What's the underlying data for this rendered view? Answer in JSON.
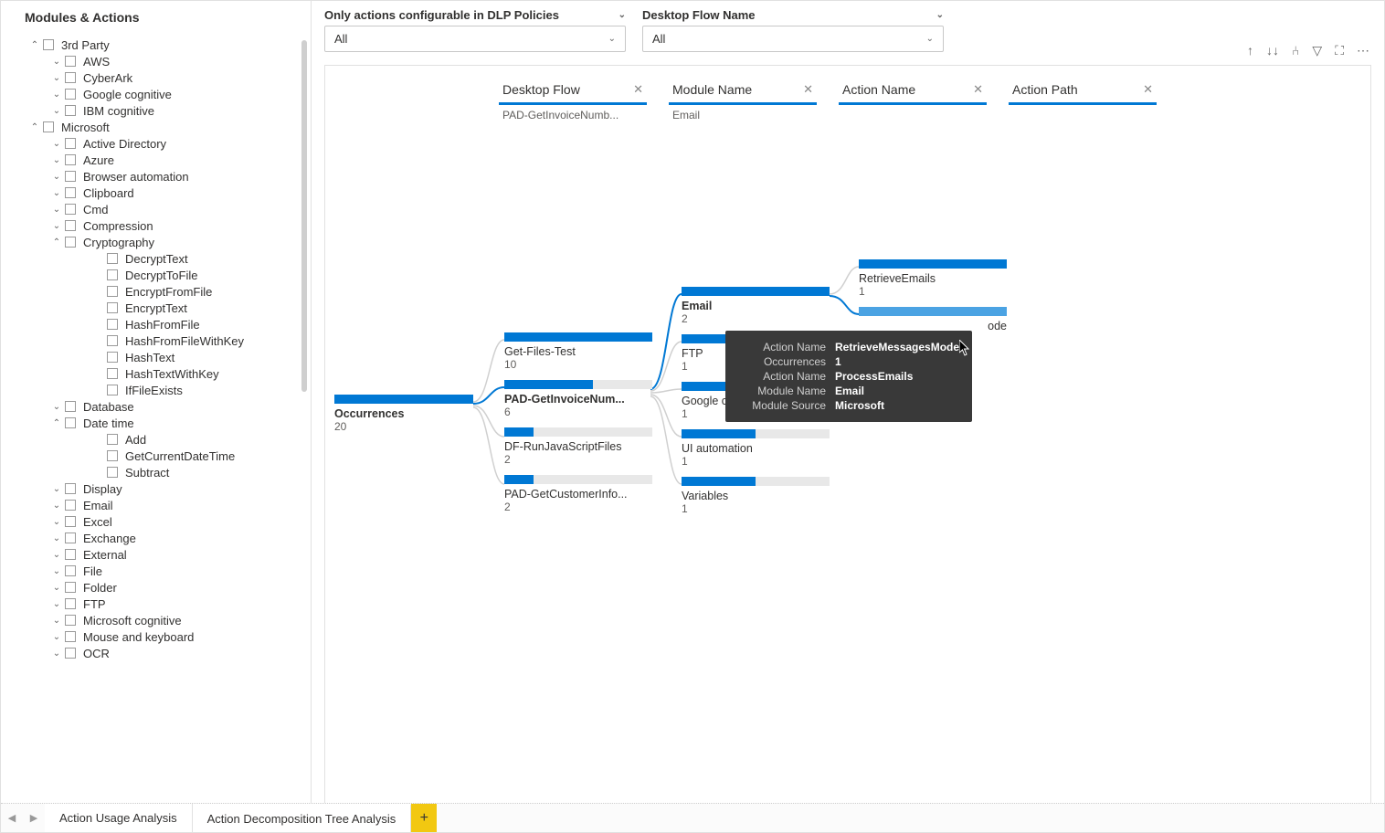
{
  "sidebar": {
    "title": "Modules & Actions",
    "tree": [
      {
        "label": "3rd Party",
        "indent": 0,
        "chev": "up"
      },
      {
        "label": "AWS",
        "indent": 1,
        "chev": "down"
      },
      {
        "label": "CyberArk",
        "indent": 1,
        "chev": "down"
      },
      {
        "label": "Google cognitive",
        "indent": 1,
        "chev": "down"
      },
      {
        "label": "IBM cognitive",
        "indent": 1,
        "chev": "down"
      },
      {
        "label": "Microsoft",
        "indent": 0,
        "chev": "up"
      },
      {
        "label": "Active Directory",
        "indent": 1,
        "chev": "down"
      },
      {
        "label": "Azure",
        "indent": 1,
        "chev": "down"
      },
      {
        "label": "Browser automation",
        "indent": 1,
        "chev": "down"
      },
      {
        "label": "Clipboard",
        "indent": 1,
        "chev": "down"
      },
      {
        "label": "Cmd",
        "indent": 1,
        "chev": "down"
      },
      {
        "label": "Compression",
        "indent": 1,
        "chev": "down"
      },
      {
        "label": "Cryptography",
        "indent": 1,
        "chev": "up"
      },
      {
        "label": "DecryptText",
        "indent": 2,
        "chev": ""
      },
      {
        "label": "DecryptToFile",
        "indent": 2,
        "chev": ""
      },
      {
        "label": "EncryptFromFile",
        "indent": 2,
        "chev": ""
      },
      {
        "label": "EncryptText",
        "indent": 2,
        "chev": ""
      },
      {
        "label": "HashFromFile",
        "indent": 2,
        "chev": ""
      },
      {
        "label": "HashFromFileWithKey",
        "indent": 2,
        "chev": ""
      },
      {
        "label": "HashText",
        "indent": 2,
        "chev": ""
      },
      {
        "label": "HashTextWithKey",
        "indent": 2,
        "chev": ""
      },
      {
        "label": "IfFileExists",
        "indent": 2,
        "chev": ""
      },
      {
        "label": "Database",
        "indent": 1,
        "chev": "down"
      },
      {
        "label": "Date time",
        "indent": 1,
        "chev": "up"
      },
      {
        "label": "Add",
        "indent": 2,
        "chev": ""
      },
      {
        "label": "GetCurrentDateTime",
        "indent": 2,
        "chev": ""
      },
      {
        "label": "Subtract",
        "indent": 2,
        "chev": ""
      },
      {
        "label": "Display",
        "indent": 1,
        "chev": "down"
      },
      {
        "label": "Email",
        "indent": 1,
        "chev": "down"
      },
      {
        "label": "Excel",
        "indent": 1,
        "chev": "down"
      },
      {
        "label": "Exchange",
        "indent": 1,
        "chev": "down"
      },
      {
        "label": "External",
        "indent": 1,
        "chev": "down"
      },
      {
        "label": "File",
        "indent": 1,
        "chev": "down"
      },
      {
        "label": "Folder",
        "indent": 1,
        "chev": "down"
      },
      {
        "label": "FTP",
        "indent": 1,
        "chev": "down"
      },
      {
        "label": "Microsoft cognitive",
        "indent": 1,
        "chev": "down"
      },
      {
        "label": "Mouse and keyboard",
        "indent": 1,
        "chev": "down"
      },
      {
        "label": "OCR",
        "indent": 1,
        "chev": "down"
      }
    ]
  },
  "filters": {
    "dlp": {
      "label": "Only actions configurable in DLP Policies",
      "value": "All"
    },
    "flow": {
      "label": "Desktop Flow Name",
      "value": "All"
    }
  },
  "columns": {
    "c1": {
      "title": "Desktop Flow",
      "sub": "PAD-GetInvoiceNumb..."
    },
    "c2": {
      "title": "Module Name",
      "sub": "Email"
    },
    "c3": {
      "title": "Action Name",
      "sub": ""
    },
    "c4": {
      "title": "Action Path",
      "sub": ""
    }
  },
  "root": {
    "label": "Occurrences",
    "value": "20"
  },
  "level1": [
    {
      "label": "Get-Files-Test",
      "value": "10",
      "fill": 100
    },
    {
      "label": "PAD-GetInvoiceNum...",
      "value": "6",
      "fill": 60,
      "bold": true
    },
    {
      "label": "DF-RunJavaScriptFiles",
      "value": "2",
      "fill": 20
    },
    {
      "label": "PAD-GetCustomerInfo...",
      "value": "2",
      "fill": 20
    }
  ],
  "level2": [
    {
      "label": "Email",
      "value": "2",
      "fill": 100,
      "bold": true
    },
    {
      "label": "FTP",
      "value": "1",
      "fill": 50
    },
    {
      "label": "Google c",
      "value": "1",
      "fill": 50
    },
    {
      "label": "UI automation",
      "value": "1",
      "fill": 50
    },
    {
      "label": "Variables",
      "value": "1",
      "fill": 50
    }
  ],
  "level3": [
    {
      "label": "RetrieveEmails",
      "value": "1",
      "fill": 100
    },
    {
      "label": "RetrieveMessagesMode",
      "value": "",
      "fill": 100,
      "selected": true,
      "truncated": "ode"
    }
  ],
  "tooltip": {
    "rows": [
      {
        "label": "Action Name",
        "value": "RetrieveMessagesMode"
      },
      {
        "label": "Occurrences",
        "value": "1"
      },
      {
        "label": "Action Name",
        "value": "ProcessEmails"
      },
      {
        "label": "Module Name",
        "value": "Email"
      },
      {
        "label": "Module Source",
        "value": "Microsoft"
      }
    ]
  },
  "tabs": {
    "t1": "Action Usage Analysis",
    "t2": "Action Decomposition Tree Analysis"
  }
}
